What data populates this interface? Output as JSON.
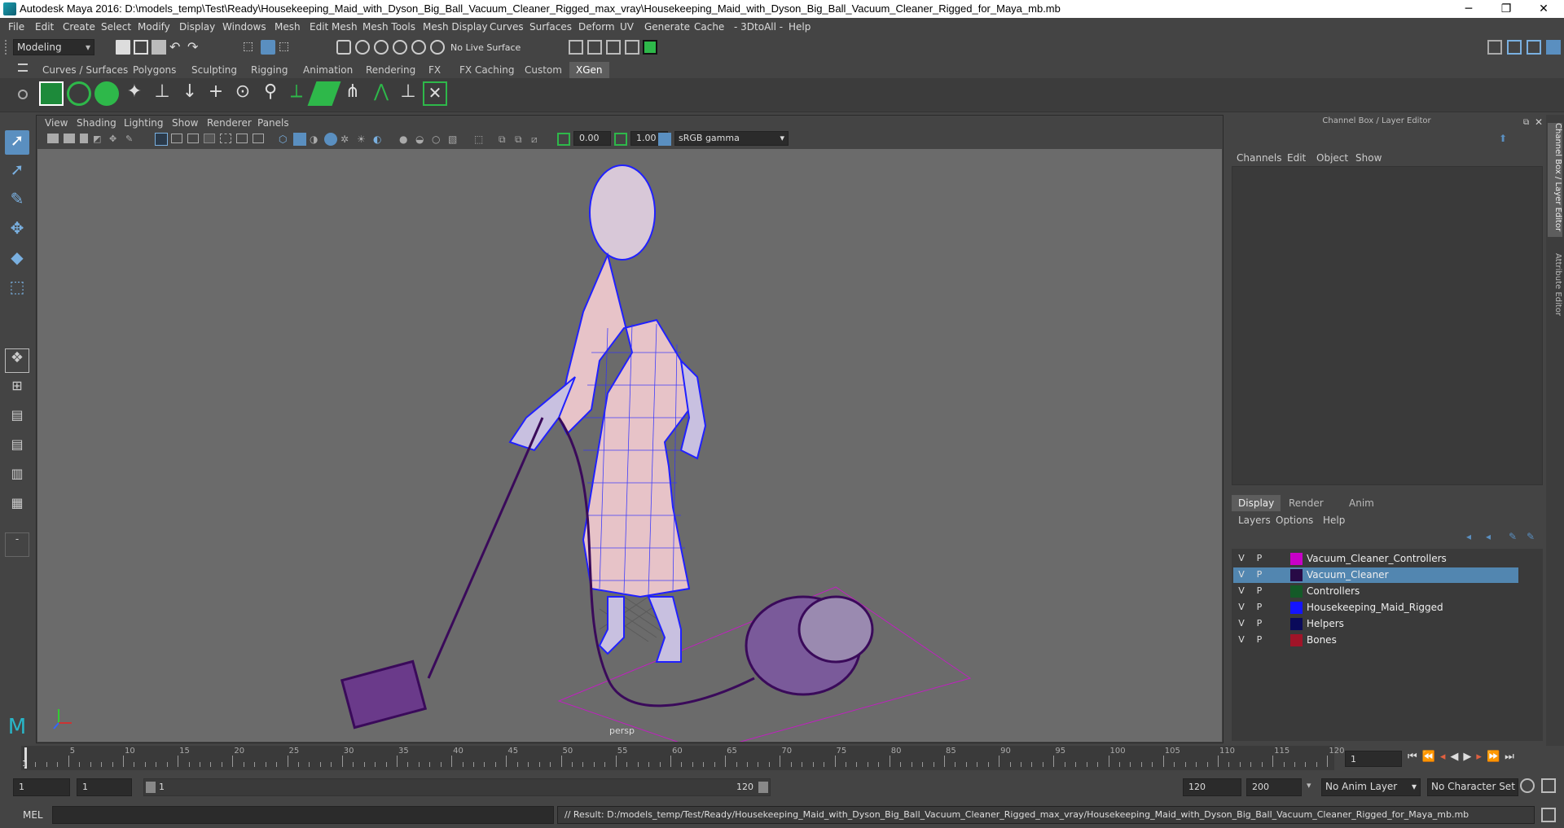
{
  "window": {
    "title": "Autodesk Maya 2016: D:\\models_temp\\Test\\Ready\\Housekeeping_Maid_with_Dyson_Big_Ball_Vacuum_Cleaner_Rigged_max_vray\\Housekeeping_Maid_with_Dyson_Big_Ball_Vacuum_Cleaner_Rigged_for_Maya_mb.mb",
    "minimize": "─",
    "maximize": "❐",
    "close": "✕"
  },
  "menu": [
    "File",
    "Edit",
    "Create",
    "Select",
    "Modify",
    "Display",
    "Windows",
    "Mesh",
    "Edit Mesh",
    "Mesh Tools",
    "Mesh Display",
    "Curves",
    "Surfaces",
    "Deform",
    "UV",
    "Generate",
    "Cache",
    "- 3DtoAll -",
    "Help"
  ],
  "statusline": {
    "mode": "Modeling",
    "live_surface": "No Live Surface"
  },
  "shelf_tabs": [
    "Curves / Surfaces",
    "Polygons",
    "Sculpting",
    "Rigging",
    "Animation",
    "Rendering",
    "FX",
    "FX Caching",
    "Custom",
    "XGen"
  ],
  "shelf_active": "XGen",
  "viewport": {
    "menu": [
      "View",
      "Shading",
      "Lighting",
      "Show",
      "Renderer",
      "Panels"
    ],
    "exposure": "0.00",
    "gamma": "1.00",
    "color_space": "sRGB gamma",
    "camera": "persp"
  },
  "channel_box": {
    "title": "Channel Box / Layer Editor",
    "menu": [
      "Channels",
      "Edit",
      "Object",
      "Show"
    ],
    "side_tabs": [
      "Channel Box / Layer Editor",
      "Attribute Editor"
    ]
  },
  "layer_editor": {
    "tabs": [
      "Display",
      "Render",
      "Anim"
    ],
    "menu": [
      "Layers",
      "Options",
      "Help"
    ],
    "layers": [
      {
        "v": "V",
        "p": "P",
        "name": "Vacuum_Cleaner_Controllers",
        "color": "#c800c8",
        "selected": false
      },
      {
        "v": "V",
        "p": "P",
        "name": "Vacuum_Cleaner",
        "color": "#280a46",
        "selected": true
      },
      {
        "v": "V",
        "p": "P",
        "name": "Controllers",
        "color": "#145a28",
        "selected": false
      },
      {
        "v": "V",
        "p": "P",
        "name": "Housekeeping_Maid_Rigged",
        "color": "#1414ff",
        "selected": false
      },
      {
        "v": "V",
        "p": "P",
        "name": "Helpers",
        "color": "#0a0a5a",
        "selected": false
      },
      {
        "v": "V",
        "p": "P",
        "name": "Bones",
        "color": "#a01428",
        "selected": false
      }
    ]
  },
  "timeline": {
    "ticks": [
      "5",
      "10",
      "15",
      "20",
      "25",
      "30",
      "35",
      "40",
      "45",
      "50",
      "55",
      "60",
      "65",
      "70",
      "75",
      "80",
      "85",
      "90",
      "95",
      "100",
      "105",
      "110",
      "115",
      "120"
    ],
    "start_label": "1",
    "current_frame": "1"
  },
  "range": {
    "start": "1",
    "start2": "1",
    "slider_start": "1",
    "slider_end": "120",
    "end": "120",
    "end2": "200",
    "anim_layer": "No Anim Layer",
    "char_set": "No Character Set"
  },
  "command": {
    "lang": "MEL",
    "result": "// Result: D:/models_temp/Test/Ready/Housekeeping_Maid_with_Dyson_Big_Ball_Vacuum_Cleaner_Rigged_max_vray/Housekeeping_Maid_with_Dyson_Big_Ball_Vacuum_Cleaner_Rigged_for_Maya_mb.mb"
  }
}
